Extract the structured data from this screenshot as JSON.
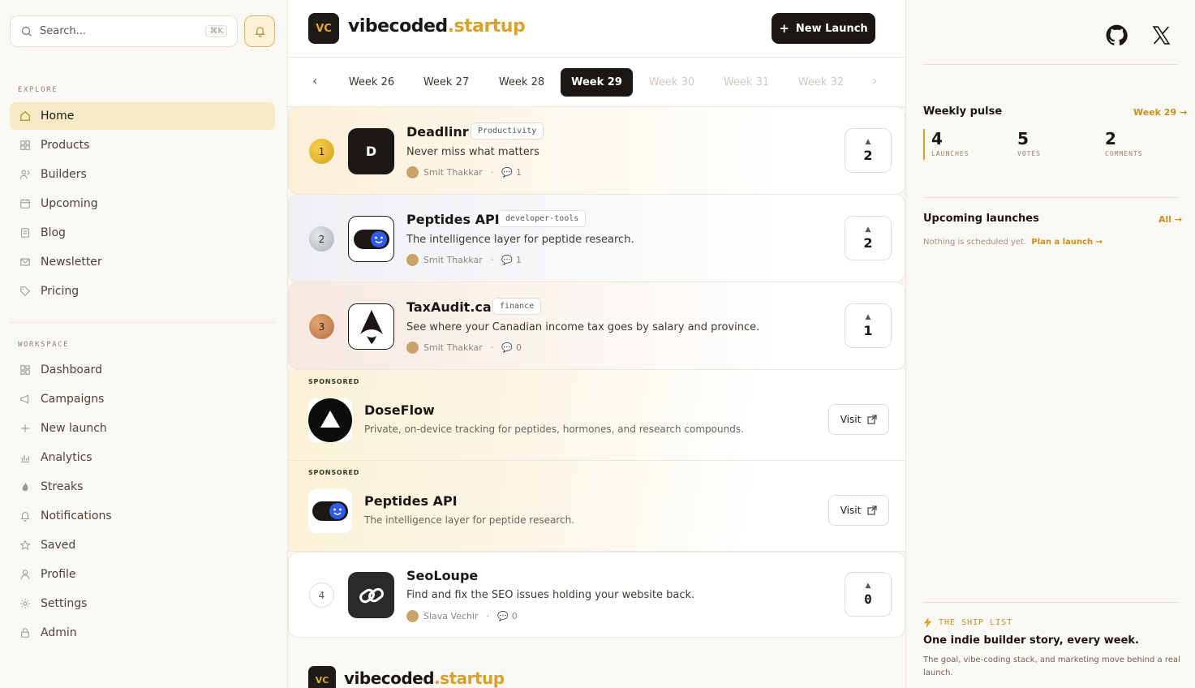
{
  "sidebar": {
    "search_placeholder": "Search...",
    "search_shortcut": "⌘K",
    "explore_label": "EXPLORE",
    "explore_items": [
      "Home",
      "Products",
      "Builders",
      "Upcoming",
      "Blog",
      "Newsletter",
      "Pricing"
    ],
    "workspace_label": "WORKSPACE",
    "workspace_items": [
      "Dashboard",
      "Campaigns",
      "New launch",
      "Analytics",
      "Streaks",
      "Notifications",
      "Saved",
      "Profile",
      "Settings",
      "Admin"
    ]
  },
  "header": {
    "logo_badge": "VC",
    "brand_main": "vibecoded",
    "brand_accent": ".startup",
    "new_launch_label": "New Launch"
  },
  "weeks": {
    "prev_arrow": "‹",
    "next_arrow": "›",
    "items": [
      "Week 26",
      "Week 27",
      "Week 28",
      "Week 29",
      "Week 30",
      "Week 31",
      "Week 32"
    ],
    "active": "Week 29"
  },
  "launches": [
    {
      "rank": "1",
      "name": "Deadlinr",
      "tag": "Productivity",
      "desc": "Never miss what matters",
      "author": "Smit Thakkar",
      "comments": "1",
      "votes": "2"
    },
    {
      "rank": "2",
      "name": "Peptides API",
      "tag": "developer-tools",
      "desc": "The intelligence layer for peptide research.",
      "author": "Smit Thakkar",
      "comments": "1",
      "votes": "2"
    },
    {
      "rank": "3",
      "name": "TaxAudit.ca",
      "tag": "finance",
      "desc": "See where your Canadian income tax goes by salary and province.",
      "author": "Smit Thakkar",
      "comments": "0",
      "votes": "1"
    },
    {
      "rank": "4",
      "name": "SeoLoupe",
      "tag": "",
      "desc": "Find and fix the SEO issues holding your website back.",
      "author": "Slava Vechir",
      "comments": "0",
      "votes": "0"
    }
  ],
  "sponsored": [
    {
      "label": "SPONSORED",
      "name": "DoseFlow",
      "desc": "Private, on-device tracking for peptides, hormones, and research compounds.",
      "cta": "Visit"
    },
    {
      "label": "SPONSORED",
      "name": "Peptides API",
      "desc": "The intelligence layer for peptide research.",
      "cta": "Visit"
    }
  ],
  "thumb_letter": "D",
  "footer_brand": {
    "badge": "VC",
    "main": "vibecoded",
    "accent": ".startup"
  },
  "right": {
    "pulse_title": "Weekly pulse",
    "pulse_link": "Week 29 →",
    "stats": [
      {
        "value": "4",
        "label": "LAUNCHES"
      },
      {
        "value": "5",
        "label": "VOTES"
      },
      {
        "value": "2",
        "label": "COMMENTS"
      }
    ],
    "upcoming_title": "Upcoming launches",
    "upcoming_link": "All →",
    "upcoming_empty": "Nothing is scheduled yet.",
    "upcoming_cta": "Plan a launch →",
    "ship_label": "THE SHIP LIST",
    "ship_title": "One indie builder story, every week.",
    "ship_desc": "The goal, vibe-coding stack, and marketing move behind a real launch."
  },
  "colors": {
    "accent": "#d9a22d",
    "dark": "#1a1714",
    "gold": "#e8b528",
    "silver": "#c9cdd3",
    "bronze": "#c68a55"
  }
}
